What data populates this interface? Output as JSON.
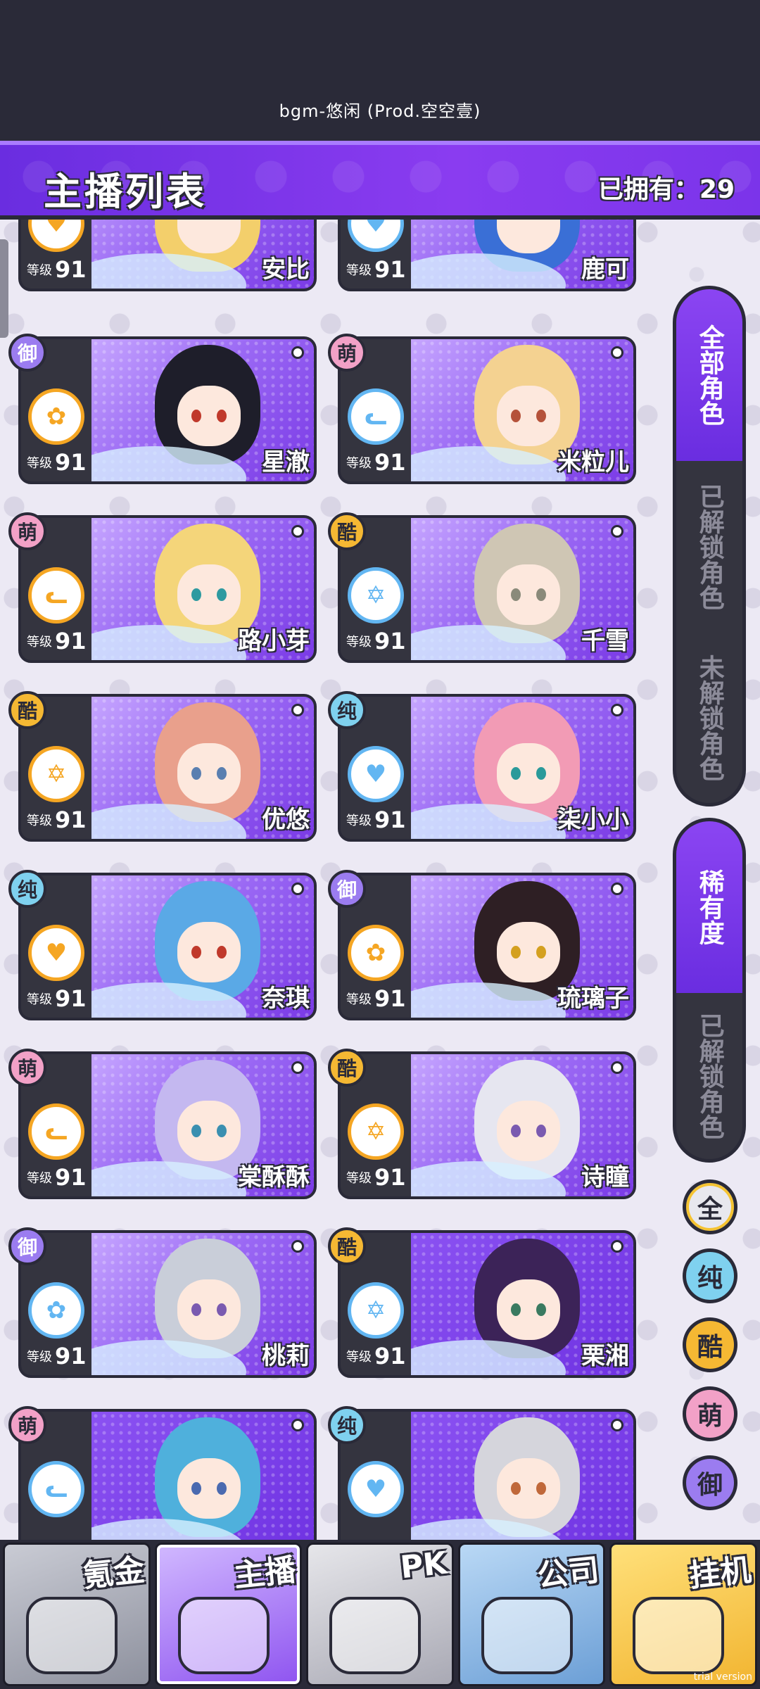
{
  "bgm": "bgm-悠闲 (Prod.空空壹)",
  "header": {
    "title": "主播列表",
    "owned": "已拥有：29"
  },
  "level_label": "等级",
  "characters": [
    {
      "name": "安比",
      "level": "91",
      "tag": "",
      "badge": "orange"
    },
    {
      "name": "鹿可",
      "level": "91",
      "tag": "",
      "badge": "blue"
    },
    {
      "name": "星澈",
      "level": "91",
      "tag": "御",
      "badge": "orange"
    },
    {
      "name": "米粒儿",
      "level": "91",
      "tag": "萌",
      "badge": "blue"
    },
    {
      "name": "路小芽",
      "level": "91",
      "tag": "萌",
      "badge": "orange"
    },
    {
      "name": "千雪",
      "level": "91",
      "tag": "酷",
      "badge": "blue"
    },
    {
      "name": "优悠",
      "level": "91",
      "tag": "酷",
      "badge": "orange"
    },
    {
      "name": "柒小小",
      "level": "91",
      "tag": "纯",
      "badge": "blue"
    },
    {
      "name": "奈琪",
      "level": "91",
      "tag": "纯",
      "badge": "orange"
    },
    {
      "name": "琉璃子",
      "level": "91",
      "tag": "御",
      "badge": "orange"
    },
    {
      "name": "棠酥酥",
      "level": "91",
      "tag": "萌",
      "badge": "orange"
    },
    {
      "name": "诗瞳",
      "level": "91",
      "tag": "酷",
      "badge": "orange"
    },
    {
      "name": "桃莉",
      "level": "91",
      "tag": "御",
      "badge": "blue"
    },
    {
      "name": "栗湘",
      "level": "91",
      "tag": "酷",
      "badge": "blue"
    },
    {
      "name": "",
      "level": "",
      "tag": "萌",
      "badge": "blue"
    },
    {
      "name": "",
      "level": "",
      "tag": "纯",
      "badge": "blue"
    }
  ],
  "filters": {
    "group1": {
      "all": "全部角色",
      "unlocked": "已解锁角色",
      "locked": "未解锁角色"
    },
    "group2": {
      "rarity": "稀有度",
      "unlocked": "已解锁角色"
    },
    "types": {
      "all": "全",
      "chun": "纯",
      "ku": "酷",
      "mo": "萌",
      "yu": "御"
    }
  },
  "bottom_nav": [
    {
      "label": "氪金"
    },
    {
      "label": "主播"
    },
    {
      "label": "PK"
    },
    {
      "label": "公司"
    },
    {
      "label": "挂机"
    }
  ],
  "watermark": "trial version",
  "colors": {
    "purple": "#7b34ea",
    "dark": "#2a2a38",
    "orange": "#f5a623",
    "blue": "#62b6f2"
  }
}
